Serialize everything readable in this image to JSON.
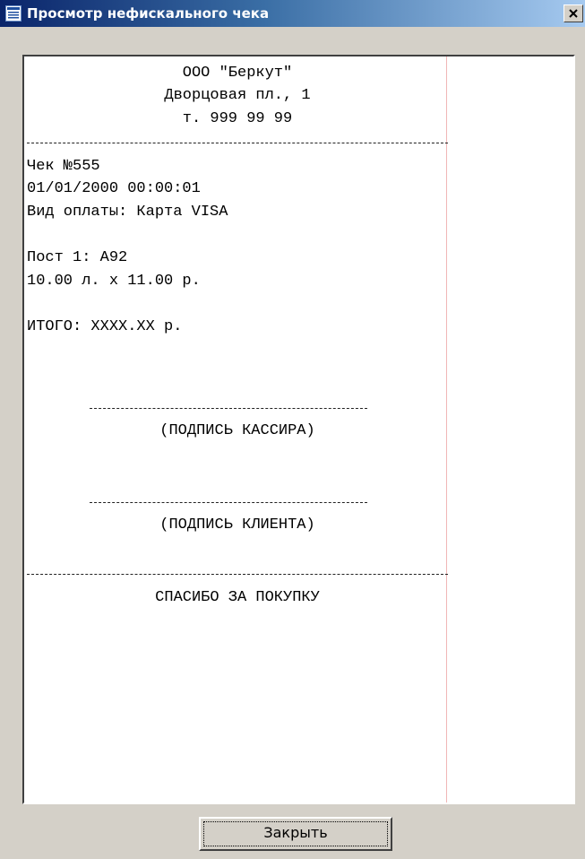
{
  "window": {
    "title": "Просмотр нефискального чека",
    "title_icon": "list-window-icon",
    "close_icon": "close-icon"
  },
  "receipt": {
    "company": "ООО \"Беркут\"",
    "address": "Дворцовая пл., 1",
    "phone": "т. 999 99 99",
    "check_number": "Чек №555",
    "datetime": "01/01/2000 00:00:01",
    "payment_type": "Вид оплаты: Карта VISA",
    "post": "Пост 1: А92",
    "quantity_price": "10.00 л. x 11.00 р.",
    "total": "ИТОГО: XXXX.XX р.",
    "cashier_signature": "(ПОДПИСЬ КАССИРА)",
    "client_signature": "(ПОДПИСЬ КЛИЕНТА)",
    "thanks": "СПАСИБО ЗА ПОКУПКУ"
  },
  "buttons": {
    "close_label": "Закрыть"
  },
  "colors": {
    "title_gradient_start": "#0a246a",
    "title_gradient_end": "#a6caf0",
    "window_face": "#d4d0c8",
    "receipt_background": "#ffffff",
    "margin_line": "#f0b7b7"
  }
}
